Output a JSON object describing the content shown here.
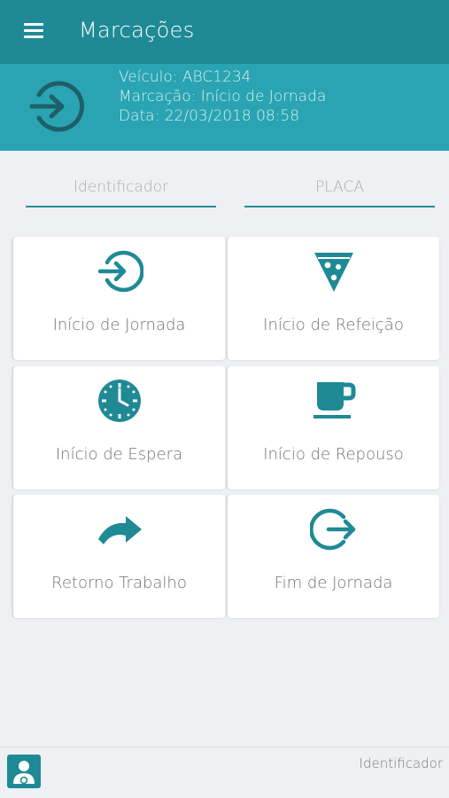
{
  "appbar": {
    "title": "Marcações",
    "menu_icon": "hamburger-menu-icon",
    "color": "#1f8a95"
  },
  "status": {
    "icon": "login-arrow-icon",
    "vehicle": "Veículo: ABC1234",
    "marking": "Marcação: Início de Jornada",
    "date": "Data: 22/03/2018 08:58",
    "color": "#2aa4b2"
  },
  "fields": {
    "identifier_placeholder": "Identificador",
    "plate_placeholder": "PLACA"
  },
  "tiles": [
    {
      "label": "Início de Jornada",
      "icon": "login-arrow-icon"
    },
    {
      "label": "Início de Refeição",
      "icon": "pizza-icon"
    },
    {
      "label": "Início de Espera",
      "icon": "clock-icon"
    },
    {
      "label": "Início de Repouso",
      "icon": "coffee-cup-icon"
    },
    {
      "label": "Retorno Trabalho",
      "icon": "redo-arrow-icon"
    },
    {
      "label": "Fim de Jornada",
      "icon": "logout-arrow-icon"
    }
  ],
  "footer": {
    "avatar_icon": "driver-avatar-icon",
    "label": "Identificador"
  },
  "accent_color": "#1f8a95"
}
